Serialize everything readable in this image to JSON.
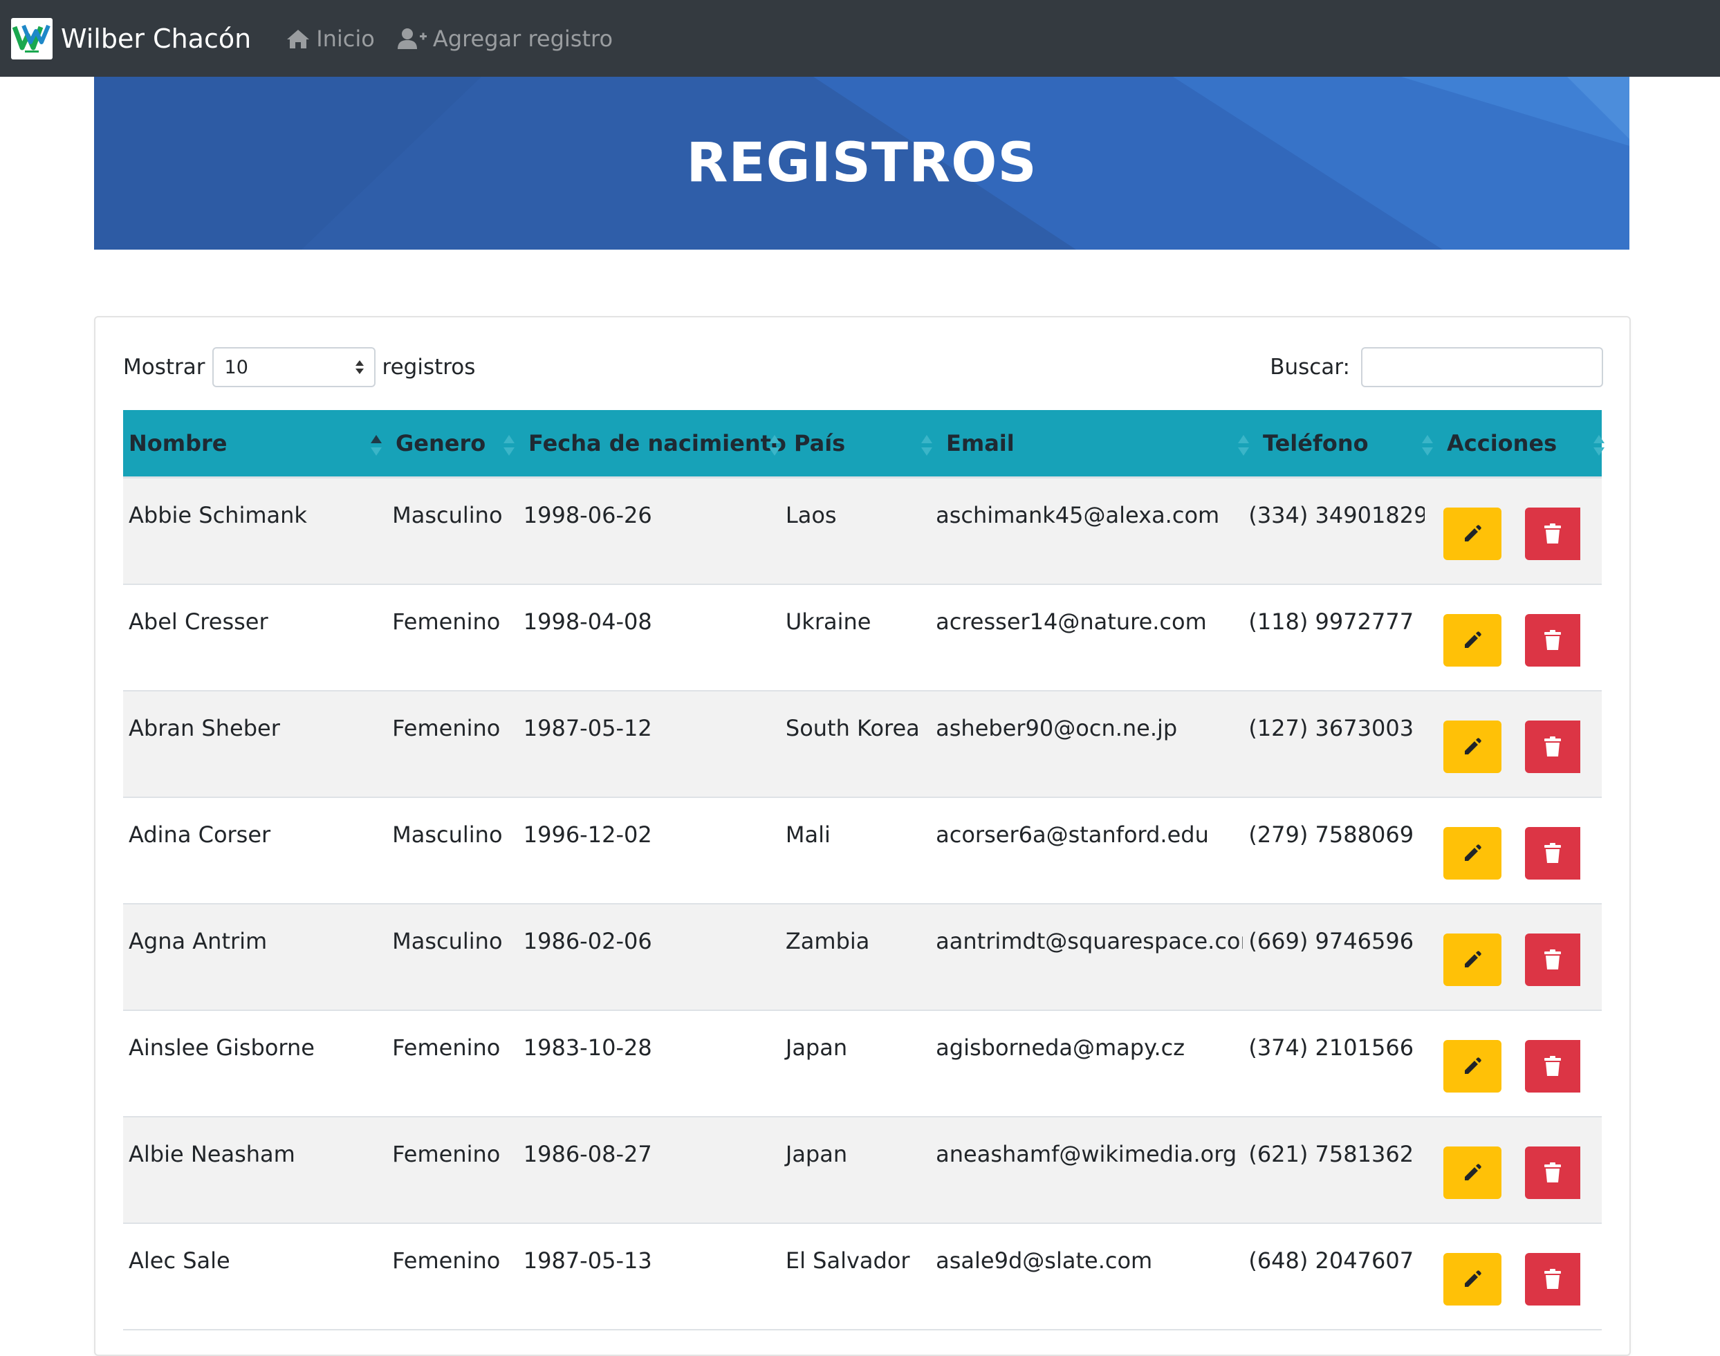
{
  "navbar": {
    "brand": "Wilber Chacón",
    "links": [
      {
        "label": "Inicio",
        "icon": "home-icon"
      },
      {
        "label": "Agregar registro",
        "icon": "user-plus-icon"
      }
    ]
  },
  "banner": {
    "title": "REGISTROS"
  },
  "table_controls": {
    "show_label": "Mostrar",
    "page_size": "10",
    "records_label": "registros",
    "search_label": "Buscar:",
    "search_value": ""
  },
  "table": {
    "columns": [
      "Nombre",
      "Genero",
      "Fecha de nacimiento",
      "País",
      "Email",
      "Teléfono",
      "Acciones"
    ],
    "sorted_column": "Nombre",
    "sort_direction": "ascending",
    "rows": [
      {
        "nombre": "Abbie Schimank",
        "genero": "Masculino",
        "fecha": "1998-06-26",
        "pais": "Laos",
        "email": "aschimank45@alexa.com",
        "telefono": "(334) 34901829"
      },
      {
        "nombre": "Abel Cresser",
        "genero": "Femenino",
        "fecha": "1998-04-08",
        "pais": "Ukraine",
        "email": "acresser14@nature.com",
        "telefono": "(118) 9972777"
      },
      {
        "nombre": "Abran Sheber",
        "genero": "Femenino",
        "fecha": "1987-05-12",
        "pais": "South Korea",
        "email": "asheber90@ocn.ne.jp",
        "telefono": "(127) 3673003"
      },
      {
        "nombre": "Adina Corser",
        "genero": "Masculino",
        "fecha": "1996-12-02",
        "pais": "Mali",
        "email": "acorser6a@stanford.edu",
        "telefono": "(279) 7588069"
      },
      {
        "nombre": "Agna Antrim",
        "genero": "Masculino",
        "fecha": "1986-02-06",
        "pais": "Zambia",
        "email": "aantrimdt@squarespace.com",
        "telefono": "(669) 9746596"
      },
      {
        "nombre": "Ainslee Gisborne",
        "genero": "Femenino",
        "fecha": "1983-10-28",
        "pais": "Japan",
        "email": "agisborneda@mapy.cz",
        "telefono": "(374) 2101566"
      },
      {
        "nombre": "Albie Neasham",
        "genero": "Femenino",
        "fecha": "1986-08-27",
        "pais": "Japan",
        "email": "aneashamf@wikimedia.org",
        "telefono": "(621) 7581362"
      },
      {
        "nombre": "Alec Sale",
        "genero": "Femenino",
        "fecha": "1987-05-13",
        "pais": "El Salvador",
        "email": "asale9d@slate.com",
        "telefono": "(648) 2047607"
      }
    ]
  },
  "colors": {
    "navbar": "#343a40",
    "banner": "#3060b0",
    "table_header": "#17a2b8",
    "edit_button": "#ffc107",
    "delete_button": "#dc3545"
  }
}
